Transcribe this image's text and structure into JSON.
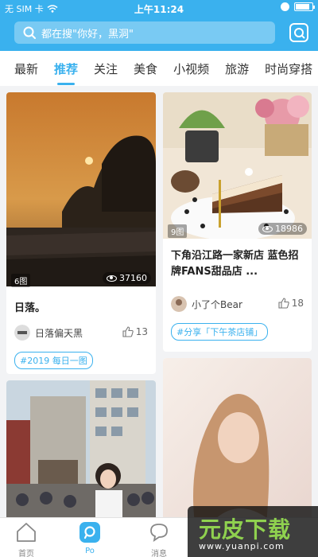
{
  "status_bar": {
    "carrier": "无 SIM 卡",
    "time": "上午11:24",
    "battery_level": 0.85
  },
  "search": {
    "placeholder": "都在搜\"你好，黑洞\""
  },
  "tabs": [
    {
      "label": "最新"
    },
    {
      "label": "推荐",
      "active": true
    },
    {
      "label": "关注"
    },
    {
      "label": "美食"
    },
    {
      "label": "小视频"
    },
    {
      "label": "旅游"
    },
    {
      "label": "时尚穿搭"
    }
  ],
  "cards": [
    {
      "image_count": "6图",
      "views": "37160",
      "title": "日落。",
      "author": "日落偏天黑",
      "likes": "13",
      "tag": "#2019 每日一图"
    },
    {
      "image_count": "9图",
      "views": "18986",
      "title": "下角沿江路一家新店 蓝色招牌FANS甜品店 ...",
      "author": "小了个Bear",
      "likes": "18",
      "tag": "#分享「下午茶店铺」"
    }
  ],
  "bottom_nav": [
    {
      "label": "首页"
    },
    {
      "label": "Po",
      "active": true
    },
    {
      "label": "消息"
    }
  ],
  "watermark": {
    "main": "元皮下载",
    "sub": "www.yuanpi.com"
  },
  "colors": {
    "accent": "#3ab1ee",
    "tag_green": "#8fd14f"
  }
}
